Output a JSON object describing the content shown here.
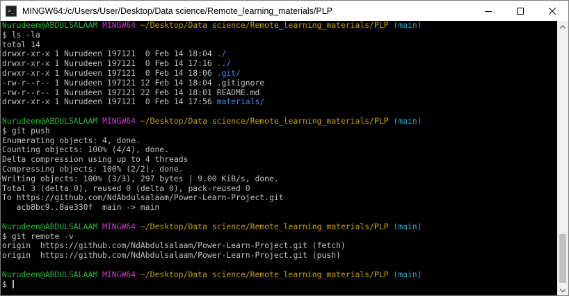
{
  "window": {
    "title": "MINGW64:/c/Users/User/Desktop/Data science/Remote_learning_materials/PLP",
    "icon": "terminal-app-icon",
    "icon_glyph": ">_",
    "controls": [
      "minimize",
      "maximize",
      "close"
    ]
  },
  "prompt": {
    "user_host": "Nurudeen@ABDULSALAAM",
    "shell": "MINGW64",
    "path": "~/Desktop/Data science/Remote_learning_materials/PLP",
    "branch": "(main)",
    "symbol": "$"
  },
  "sessions": [
    {
      "command": "ls -la",
      "output": [
        {
          "text": "total 14"
        },
        {
          "text": "drwxr-xr-x 1 Nurudeen 197121  0 Feb 14 18:04 ",
          "name": "./",
          "kind": "dir"
        },
        {
          "text": "drwxr-xr-x 1 Nurudeen 197121  0 Feb 14 17:16 ",
          "name": "../",
          "kind": "dir"
        },
        {
          "text": "drwxr-xr-x 1 Nurudeen 197121  0 Feb 14 18:06 ",
          "name": ".git/",
          "kind": "dir"
        },
        {
          "text": "-rw-r--r-- 1 Nurudeen 197121 12 Feb 14 18:04 ",
          "name": ".gitignore",
          "kind": "file"
        },
        {
          "text": "-rw-r--r-- 1 Nurudeen 197121 22 Feb 14 18:01 ",
          "name": "README.md",
          "kind": "file"
        },
        {
          "text": "drwxr-xr-x 1 Nurudeen 197121  0 Feb 14 17:56 ",
          "name": "materials/",
          "kind": "dir"
        }
      ]
    },
    {
      "command": "git push",
      "output": [
        {
          "text": "Enumerating objects: 4, done."
        },
        {
          "text": "Counting objects: 100% (4/4), done."
        },
        {
          "text": "Delta compression using up to 4 threads"
        },
        {
          "text": "Compressing objects: 100% (2/2), done."
        },
        {
          "text": "Writing objects: 100% (3/3), 297 bytes | 9.00 KiB/s, done."
        },
        {
          "text": "Total 3 (delta 0), reused 0 (delta 0), pack-reused 0"
        },
        {
          "text": "To https://github.com/NdAbdulsalaam/Power-Learn-Project.git"
        },
        {
          "text": "   acb8bc9..8ae330f  main -> main"
        }
      ]
    },
    {
      "command": "git remote -v",
      "output": [
        {
          "text": "origin  https://github.com/NdAbdulsalaam/Power-Learn-Project.git (fetch)"
        },
        {
          "text": "origin  https://github.com/NdAbdulsalaam/Power-Learn-Project.git (push)"
        }
      ]
    }
  ],
  "colors": {
    "prompt_user": "#26b43a",
    "prompt_shell": "#c93ac6",
    "prompt_path": "#c4a000",
    "prompt_branch": "#2fa9c9",
    "directory": "#3b8eea",
    "text": "#c0c0c0",
    "background": "#000000"
  }
}
